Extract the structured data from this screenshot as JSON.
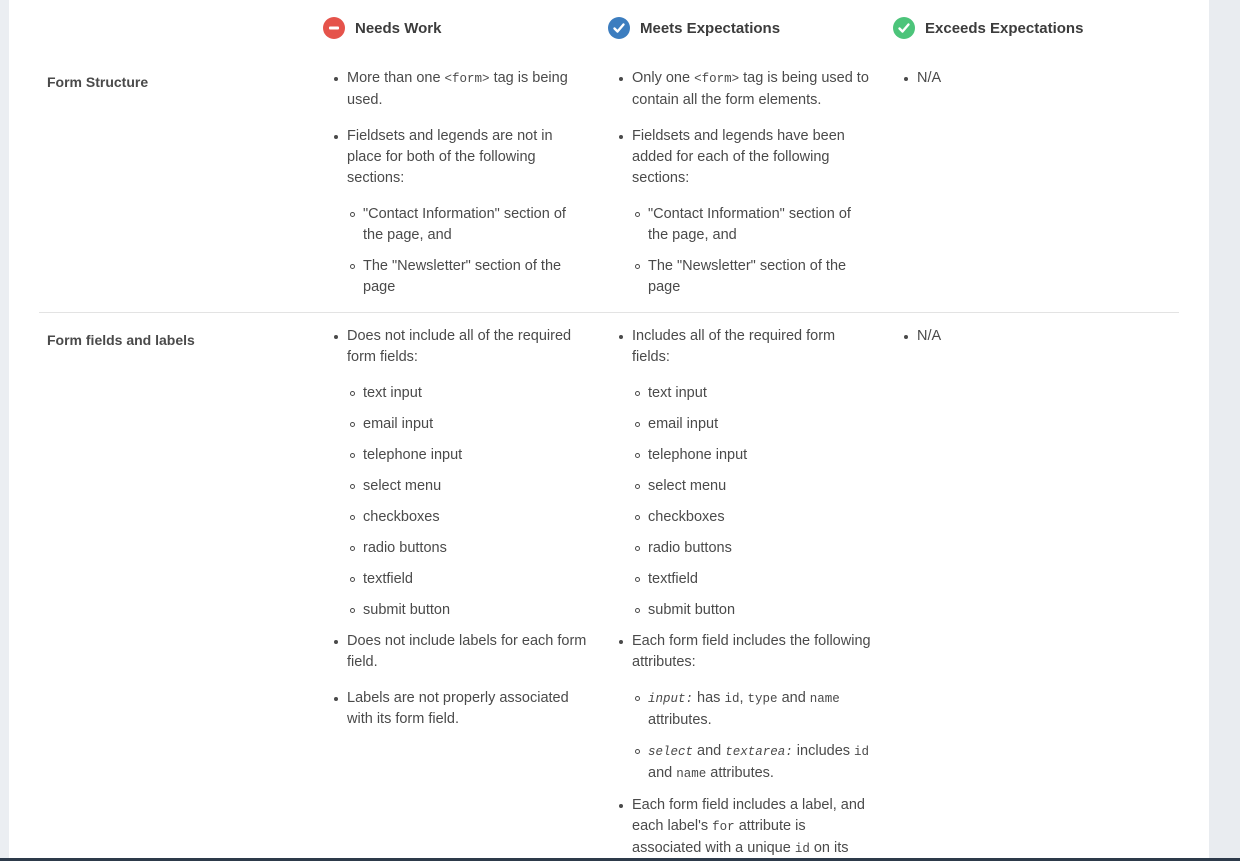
{
  "colors": {
    "needs_work": "#e5534b",
    "meets": "#3c7dbf",
    "exceeds": "#4cc47a"
  },
  "header": {
    "needs_work": {
      "label": "Needs Work",
      "icon": "minus-circle-icon"
    },
    "meets": {
      "label": "Meets Expectations",
      "icon": "check-circle-icon"
    },
    "exceeds": {
      "label": "Exceeds Expectations",
      "icon": "check-circle-icon"
    }
  },
  "rows": [
    {
      "criterion": "Form Structure",
      "needs_work": {
        "b1_pre": "More than one ",
        "b1_code": "<form>",
        "b1_post": " tag is being used.",
        "b2": "Fieldsets and legends are not in place for both of the following sections:",
        "b2_sub": [
          "\"Contact Information\" section of the page, and",
          "The \"Newsletter\" section of the page"
        ]
      },
      "meets": {
        "b1_pre": "Only one ",
        "b1_code": "<form>",
        "b1_post": " tag is being used to contain all the form elements.",
        "b2": "Fieldsets and legends have been added for each of the following sections:",
        "b2_sub": [
          "\"Contact Information\" section of the page, and",
          "The \"Newsletter\" section of the page"
        ]
      },
      "exceeds": [
        "N/A"
      ]
    },
    {
      "criterion": "Form fields and labels",
      "needs_work": {
        "b1": "Does not include all of the required form fields:",
        "b1_sub": [
          "text input",
          "email input",
          "telephone input",
          "select menu",
          "checkboxes",
          "radio buttons",
          "textfield",
          "submit button"
        ],
        "b2": "Does not include labels for each form field.",
        "b3": "Labels are not properly associated with its form field."
      },
      "meets": {
        "b1": "Includes all of the required form fields:",
        "b1_sub": [
          "text input",
          "email input",
          "telephone input",
          "select menu",
          "checkboxes",
          "radio buttons",
          "textfield",
          "submit button"
        ],
        "b2": "Each form field includes the following attributes:",
        "b2_sub1": {
          "code1": "input:",
          "t1": " has ",
          "c2": "id",
          "t2": ", ",
          "c3": "type",
          "t3": " and ",
          "c4": "name",
          "t4": " attributes."
        },
        "b2_sub2": {
          "code1": "select",
          "t1": " and ",
          "c2": "textarea:",
          "t2": " includes ",
          "c3": "id",
          "t3": " and ",
          "c4": "name",
          "t4": " attributes."
        },
        "b3": {
          "t1": "Each form field includes a label, and each label's ",
          "c1": "for",
          "t2": " attribute is associated with a unique ",
          "c2": "id",
          "t3": " on its"
        }
      },
      "exceeds": [
        "N/A"
      ]
    }
  ]
}
